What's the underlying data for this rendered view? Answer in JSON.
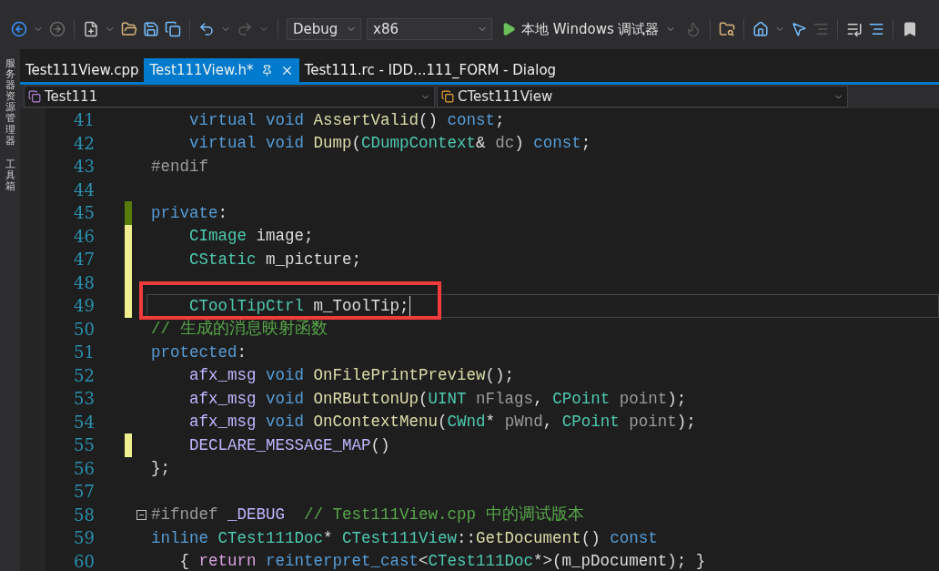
{
  "side_panels": [
    {
      "label": "服务器资源管理器"
    },
    {
      "label": "工具箱"
    }
  ],
  "toolbar": {
    "configuration": "Debug",
    "platform": "x86",
    "run_label": "本地 Windows 调试器"
  },
  "tabs": [
    {
      "label": "Test111View.cpp",
      "selected": false
    },
    {
      "label": "Test111View.h*",
      "selected": true
    },
    {
      "label": "Test111.rc - IDD...111_FORM - Dialog",
      "selected": false
    }
  ],
  "nav": {
    "project": "Test111",
    "scope": "CTest111View"
  },
  "lines": [
    {
      "number": "41",
      "current": false,
      "highlighted": false,
      "collapsible": false,
      "tokens": [
        {
          "text": "    virtual ",
          "kind": "kw"
        },
        {
          "text": "void ",
          "kind": "kw"
        },
        {
          "text": "AssertValid",
          "kind": "fn"
        },
        {
          "text": "() ",
          "kind": "plain"
        },
        {
          "text": "const",
          "kind": "kw"
        },
        {
          "text": ";",
          "kind": "plain"
        }
      ]
    },
    {
      "number": "42",
      "current": false,
      "highlighted": false,
      "collapsible": false,
      "tokens": [
        {
          "text": "    virtual ",
          "kind": "kw"
        },
        {
          "text": "void ",
          "kind": "kw"
        },
        {
          "text": "Dump",
          "kind": "fn"
        },
        {
          "text": "(",
          "kind": "plain"
        },
        {
          "text": "CDumpContext",
          "kind": "type"
        },
        {
          "text": "& ",
          "kind": "plain"
        },
        {
          "text": "dc",
          "kind": "param"
        },
        {
          "text": ") ",
          "kind": "plain"
        },
        {
          "text": "const",
          "kind": "kw"
        },
        {
          "text": ";",
          "kind": "plain"
        }
      ]
    },
    {
      "number": "43",
      "current": false,
      "highlighted": false,
      "collapsible": false,
      "tokens": [
        {
          "text": "#endif",
          "kind": "pre"
        }
      ]
    },
    {
      "number": "44",
      "current": false,
      "highlighted": false,
      "collapsible": false
    },
    {
      "number": "45",
      "color": "#587c0c",
      "current": false,
      "highlighted": false,
      "collapsible": false,
      "tokens": [
        {
          "text": "private",
          "kind": "kw"
        },
        {
          "text": ":",
          "kind": "plain"
        }
      ]
    },
    {
      "number": "46",
      "color": "#efef8f",
      "current": false,
      "highlighted": false,
      "collapsible": false,
      "tokens": [
        {
          "text": "    CImage ",
          "kind": "type"
        },
        {
          "text": "image;",
          "kind": "plain"
        }
      ]
    },
    {
      "number": "47",
      "color": "#efef8f",
      "current": false,
      "highlighted": false,
      "collapsible": false,
      "tokens": [
        {
          "text": "    CStatic ",
          "kind": "type"
        },
        {
          "text": "m_picture;",
          "kind": "plain"
        }
      ]
    },
    {
      "number": "48",
      "color": "#efef8f",
      "current": false,
      "highlighted": false,
      "collapsible": false
    },
    {
      "number": "49",
      "color": "#efef8f",
      "current": true,
      "highlighted": true,
      "collapsible": false,
      "tokens": [
        {
          "text": "    CToolTipCtrl ",
          "kind": "type"
        },
        {
          "text": "m_ToolTip;",
          "kind": "plain"
        }
      ]
    },
    {
      "number": "50",
      "current": false,
      "highlighted": false,
      "collapsible": false,
      "tokens": [
        {
          "text": "// 生成的消息映射函数",
          "kind": "cmt"
        }
      ]
    },
    {
      "number": "51",
      "current": false,
      "highlighted": false,
      "collapsible": false,
      "tokens": [
        {
          "text": "protected",
          "kind": "kw"
        },
        {
          "text": ":",
          "kind": "plain"
        }
      ]
    },
    {
      "number": "52",
      "current": false,
      "highlighted": false,
      "collapsible": false,
      "tokens": [
        {
          "text": "    afx_msg ",
          "kind": "macro"
        },
        {
          "text": "void ",
          "kind": "kw"
        },
        {
          "text": "OnFilePrintPreview",
          "kind": "fn"
        },
        {
          "text": "();",
          "kind": "plain"
        }
      ]
    },
    {
      "number": "53",
      "current": false,
      "highlighted": false,
      "collapsible": false,
      "tokens": [
        {
          "text": "    afx_msg ",
          "kind": "macro"
        },
        {
          "text": "void ",
          "kind": "kw"
        },
        {
          "text": "OnRButtonUp",
          "kind": "fn"
        },
        {
          "text": "(",
          "kind": "plain"
        },
        {
          "text": "UINT ",
          "kind": "type"
        },
        {
          "text": "nFlags",
          "kind": "param"
        },
        {
          "text": ", ",
          "kind": "plain"
        },
        {
          "text": "CPoint ",
          "kind": "type"
        },
        {
          "text": "point",
          "kind": "param"
        },
        {
          "text": ");",
          "kind": "plain"
        }
      ]
    },
    {
      "number": "54",
      "current": false,
      "highlighted": false,
      "collapsible": false,
      "tokens": [
        {
          "text": "    afx_msg ",
          "kind": "macro"
        },
        {
          "text": "void ",
          "kind": "kw"
        },
        {
          "text": "OnContextMenu",
          "kind": "fn"
        },
        {
          "text": "(",
          "kind": "plain"
        },
        {
          "text": "CWnd",
          "kind": "type"
        },
        {
          "text": "* ",
          "kind": "plain"
        },
        {
          "text": "pWnd",
          "kind": "param"
        },
        {
          "text": ", ",
          "kind": "plain"
        },
        {
          "text": "CPoint ",
          "kind": "type"
        },
        {
          "text": "point",
          "kind": "param"
        },
        {
          "text": ");",
          "kind": "plain"
        }
      ]
    },
    {
      "number": "55",
      "color": "#efef8f",
      "current": false,
      "highlighted": false,
      "collapsible": false,
      "tokens": [
        {
          "text": "    DECLARE_MESSAGE_MAP",
          "kind": "macro"
        },
        {
          "text": "()",
          "kind": "plain"
        }
      ]
    },
    {
      "number": "56",
      "current": false,
      "highlighted": false,
      "collapsible": false,
      "tokens": [
        {
          "text": "};",
          "kind": "plain"
        }
      ]
    },
    {
      "number": "57",
      "current": false,
      "highlighted": false,
      "collapsible": false
    },
    {
      "number": "58",
      "current": false,
      "highlighted": false,
      "collapsible": true,
      "tokens": [
        {
          "text": "#ifndef ",
          "kind": "pre"
        },
        {
          "text": "_DEBUG",
          "kind": "macro"
        },
        {
          "text": "  // Test111View.cpp 中的调试版本",
          "kind": "cmt"
        }
      ]
    },
    {
      "number": "59",
      "current": false,
      "highlighted": false,
      "collapsible": false,
      "tokens": [
        {
          "text": "inline ",
          "kind": "kw"
        },
        {
          "text": "CTest111Doc",
          "kind": "type"
        },
        {
          "text": "* ",
          "kind": "plain"
        },
        {
          "text": "CTest111View",
          "kind": "type"
        },
        {
          "text": "::",
          "kind": "plain"
        },
        {
          "text": "GetDocument",
          "kind": "fn"
        },
        {
          "text": "() ",
          "kind": "plain"
        },
        {
          "text": "const",
          "kind": "kw"
        }
      ]
    },
    {
      "number": "60",
      "current": false,
      "highlighted": false,
      "collapsible": false,
      "tokens": [
        {
          "text": "   { ",
          "kind": "plain"
        },
        {
          "text": "return ",
          "kind": "ctl"
        },
        {
          "text": "reinterpret_cast",
          "kind": "kw"
        },
        {
          "text": "<",
          "kind": "plain"
        },
        {
          "text": "CTest111Doc",
          "kind": "type"
        },
        {
          "text": "*>(m_pDocument); }",
          "kind": "plain"
        }
      ]
    }
  ]
}
